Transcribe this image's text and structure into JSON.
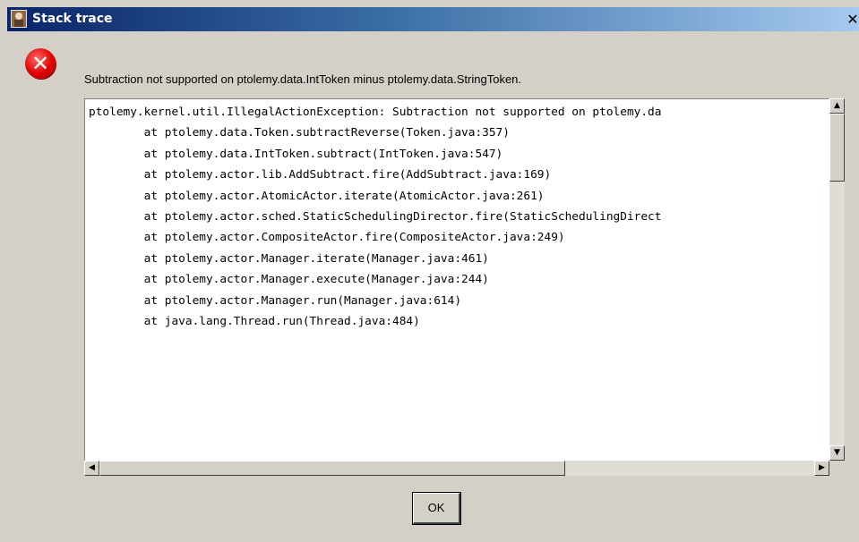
{
  "window": {
    "title": "Stack trace",
    "close_glyph": "✕"
  },
  "error_icon": {
    "name": "error-icon",
    "glyph": "✕",
    "color": "#e00000"
  },
  "message": "Subtraction not supported on ptolemy.data.IntToken minus ptolemy.data.StringToken.",
  "trace_lines": [
    "ptolemy.kernel.util.IllegalActionException: Subtraction not supported on ptolemy.da",
    "        at ptolemy.data.Token.subtractReverse(Token.java:357)",
    "        at ptolemy.data.IntToken.subtract(IntToken.java:547)",
    "        at ptolemy.actor.lib.AddSubtract.fire(AddSubtract.java:169)",
    "        at ptolemy.actor.AtomicActor.iterate(AtomicActor.java:261)",
    "        at ptolemy.actor.sched.StaticSchedulingDirector.fire(StaticSchedulingDirect",
    "        at ptolemy.actor.CompositeActor.fire(CompositeActor.java:249)",
    "        at ptolemy.actor.Manager.iterate(Manager.java:461)",
    "        at ptolemy.actor.Manager.execute(Manager.java:244)",
    "        at ptolemy.actor.Manager.run(Manager.java:614)",
    "        at java.lang.Thread.run(Thread.java:484)"
  ],
  "scrollbars": {
    "up_glyph": "▲",
    "down_glyph": "▼",
    "left_glyph": "◀",
    "right_glyph": "▶"
  },
  "buttons": {
    "ok_label": "OK"
  },
  "colors": {
    "titlebar_start": "#0a246a",
    "titlebar_end": "#a6caf0",
    "dialog_bg": "#d4d0c8"
  }
}
